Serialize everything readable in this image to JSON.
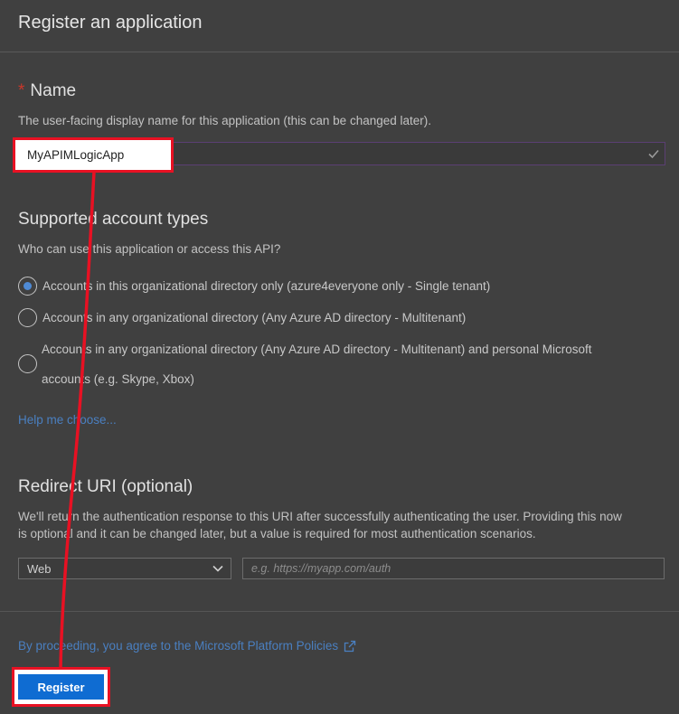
{
  "header": {
    "title": "Register an application"
  },
  "name_section": {
    "required_mark": "*",
    "title": "Name",
    "description": "The user-facing display name for this application (this can be changed later).",
    "value": "MyAPIMLogicApp"
  },
  "account_types": {
    "title": "Supported account types",
    "question": "Who can use this application or access this API?",
    "options": [
      {
        "label": "Accounts in this organizational directory only (azure4everyone only - Single tenant)",
        "selected": true
      },
      {
        "label": "Accounts in any organizational directory (Any Azure AD directory - Multitenant)",
        "selected": false
      },
      {
        "label": "Accounts in any organizational directory (Any Azure AD directory - Multitenant) and personal Microsoft accounts (e.g. Skype, Xbox)",
        "selected": false
      }
    ],
    "option3_line1": "Accounts in any organizational directory (Any Azure AD directory - Multitenant) and personal Microsoft",
    "option3_line2": "accounts (e.g. Skype, Xbox)",
    "help_link": "Help me choose..."
  },
  "redirect": {
    "title": "Redirect URI (optional)",
    "description_line1": "We'll return the authentication response to this URI after successfully authenticating the user. Providing this now",
    "description_line2": "is optional and it can be changed later, but a value is required for most authentication scenarios.",
    "platform_selected": "Web",
    "uri_placeholder": "e.g. https://myapp.com/auth"
  },
  "footer": {
    "policy_text": "By proceeding, you agree to the Microsoft Platform Policies",
    "register_label": "Register"
  },
  "colors": {
    "highlight": "#e81123",
    "primary_button": "#0f6cd2",
    "link": "#4a7fc0"
  }
}
